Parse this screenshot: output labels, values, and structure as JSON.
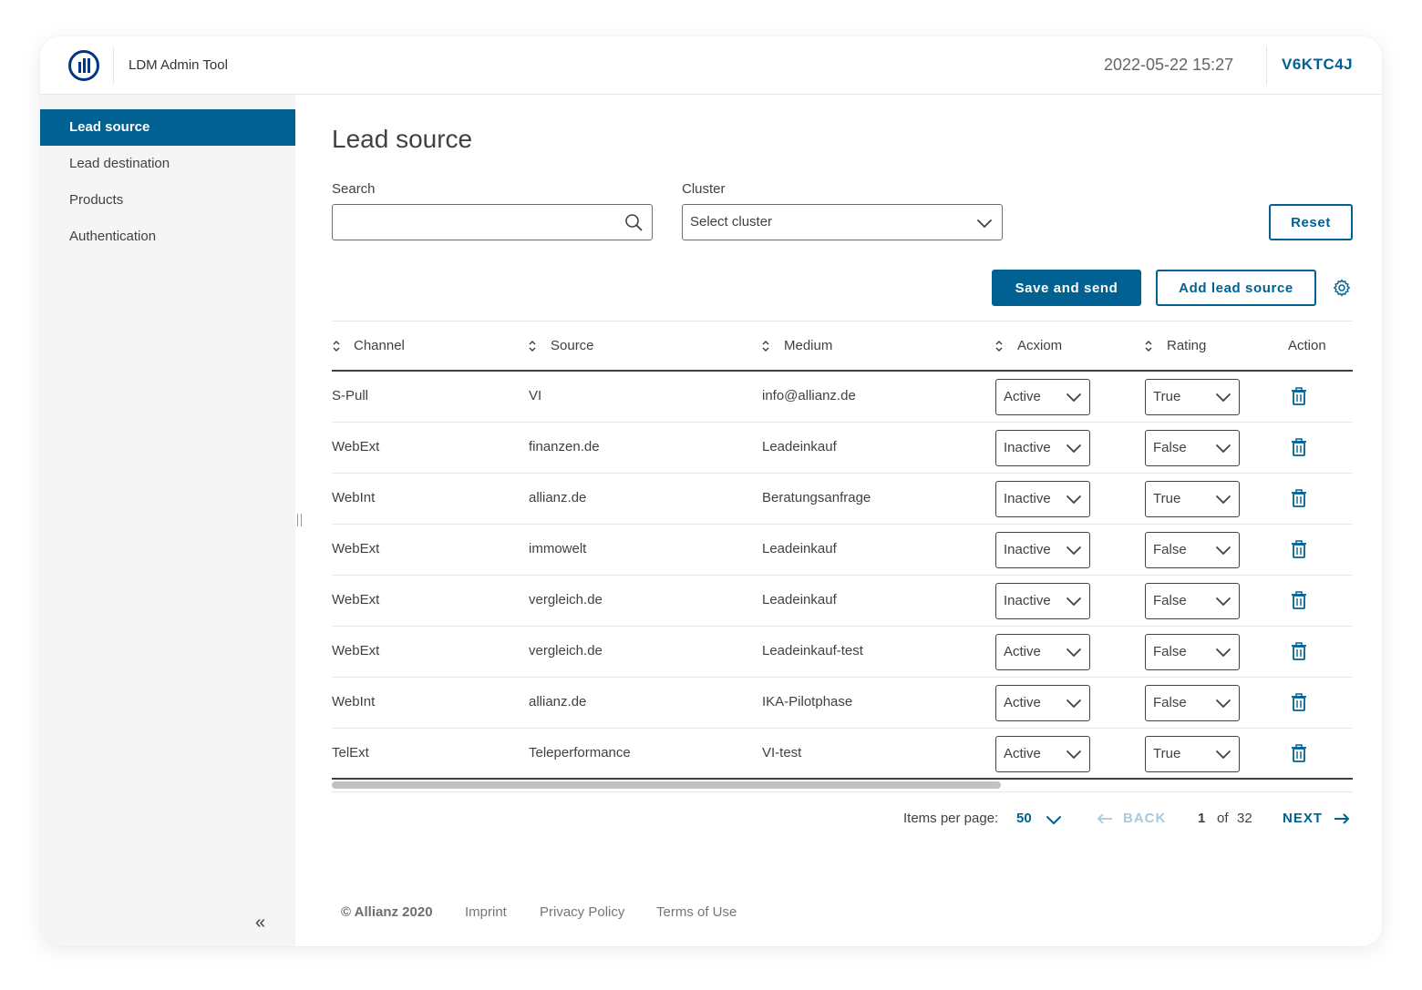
{
  "header": {
    "app_title": "LDM Admin Tool",
    "datetime": "2022-05-22 15:27",
    "user_code": "V6KTC4J"
  },
  "sidebar": {
    "items": [
      {
        "label": "Lead source",
        "active": true
      },
      {
        "label": "Lead destination",
        "active": false
      },
      {
        "label": "Products",
        "active": false
      },
      {
        "label": "Authentication",
        "active": false
      }
    ],
    "collapse_glyph": "«"
  },
  "main": {
    "title": "Lead source",
    "search": {
      "label": "Search",
      "value": "",
      "placeholder": ""
    },
    "cluster": {
      "label": "Cluster",
      "value": "Select cluster"
    },
    "reset_label": "Reset",
    "save_label": "Save and send",
    "add_label": "Add lead source"
  },
  "table": {
    "columns": [
      "Channel",
      "Source",
      "Medium",
      "Acxiom",
      "Rating",
      "Action"
    ],
    "rows": [
      {
        "channel": "S-Pull",
        "source": "VI",
        "medium": "info@allianz.de",
        "acxiom": "Active",
        "rating": "True"
      },
      {
        "channel": "WebExt",
        "source": "finanzen.de",
        "medium": "Leadeinkauf",
        "acxiom": "Inactive",
        "rating": "False"
      },
      {
        "channel": "WebInt",
        "source": "allianz.de",
        "medium": "Beratungsanfrage",
        "acxiom": "Inactive",
        "rating": "True"
      },
      {
        "channel": "WebExt",
        "source": "immowelt",
        "medium": "Leadeinkauf",
        "acxiom": "Inactive",
        "rating": "False"
      },
      {
        "channel": "WebExt",
        "source": "vergleich.de",
        "medium": "Leadeinkauf",
        "acxiom": "Inactive",
        "rating": "False"
      },
      {
        "channel": "WebExt",
        "source": "vergleich.de",
        "medium": "Leadeinkauf-test",
        "acxiom": "Active",
        "rating": "False"
      },
      {
        "channel": "WebInt",
        "source": "allianz.de",
        "medium": "IKA-Pilotphase",
        "acxiom": "Active",
        "rating": "False"
      },
      {
        "channel": "TelExt",
        "source": "Teleperformance",
        "medium": "VI-test",
        "acxiom": "Active",
        "rating": "True"
      }
    ]
  },
  "pagination": {
    "items_per_page_label": "Items per page:",
    "items_per_page": "50",
    "back_label": "BACK",
    "current_page": "1",
    "of_label": "of",
    "total_pages": "32",
    "next_label": "NEXT"
  },
  "footer": {
    "copyright": "© Allianz 2020",
    "links": [
      "Imprint",
      "Privacy Policy",
      "Terms of Use"
    ]
  },
  "colors": {
    "accent": "#006192",
    "brand": "#003781",
    "text": "#414141",
    "sidebar_bg": "#f5f5f5"
  }
}
